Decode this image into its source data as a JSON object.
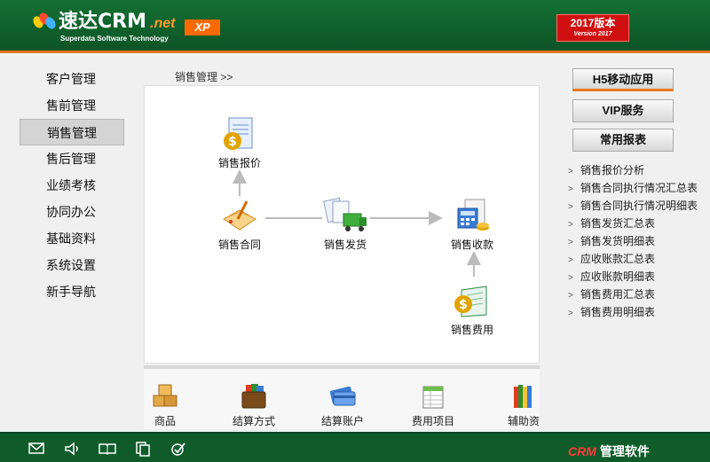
{
  "header": {
    "logo_cn": "速达",
    "logo_crm": "CRM",
    "logo_net": ".net",
    "logo_sub": "Superdata Software Technology",
    "xp_badge": "XP",
    "version_title": "2017版本",
    "version_sub": "Version 2017",
    "colors": {
      "header_green": "#0f5c2a",
      "accent_orange": "#e87722",
      "version_red": "#d01010"
    }
  },
  "left_nav": {
    "items": [
      {
        "label": "客户管理",
        "active": false
      },
      {
        "label": "售前管理",
        "active": false
      },
      {
        "label": "销售管理",
        "active": true
      },
      {
        "label": "售后管理",
        "active": false
      },
      {
        "label": "业绩考核",
        "active": false
      },
      {
        "label": "协同办公",
        "active": false
      },
      {
        "label": "基础资料",
        "active": false
      },
      {
        "label": "系统设置",
        "active": false
      },
      {
        "label": "新手导航",
        "active": false
      }
    ]
  },
  "breadcrumb": "销售管理 >>",
  "flow": {
    "quote": {
      "label": "销售报价",
      "icon": "quote-document-icon"
    },
    "contract": {
      "label": "销售合同",
      "icon": "contract-icon"
    },
    "delivery": {
      "label": "销售发货",
      "icon": "delivery-truck-icon"
    },
    "receipt": {
      "label": "销售收款",
      "icon": "calculator-money-icon"
    },
    "expense": {
      "label": "销售费用",
      "icon": "expense-book-icon"
    }
  },
  "toolbar": {
    "items": [
      {
        "label": "商品",
        "icon": "boxes-icon"
      },
      {
        "label": "结算方式",
        "icon": "wallet-icon"
      },
      {
        "label": "结算账户",
        "icon": "bank-card-icon"
      },
      {
        "label": "费用项目",
        "icon": "expense-items-icon"
      },
      {
        "label": "辅助资",
        "icon": "books-icon"
      }
    ]
  },
  "right_panel": {
    "buttons": {
      "mobile": "H5移动应用",
      "vip": "VIP服务",
      "reports": "常用报表"
    },
    "report_links": [
      "销售报价分析",
      "销售合同执行情况汇总表",
      "销售合同执行情况明细表",
      "销售发货汇总表",
      "销售发货明细表",
      "应收账款汇总表",
      "应收账款明细表",
      "销售费用汇总表",
      "销售费用明细表"
    ]
  },
  "footer": {
    "brand_crm": "CRM",
    "brand_text": "管理软件",
    "icons": [
      "mail-icon",
      "speaker-icon",
      "book-icon",
      "copy-icon",
      "check-icon"
    ]
  }
}
